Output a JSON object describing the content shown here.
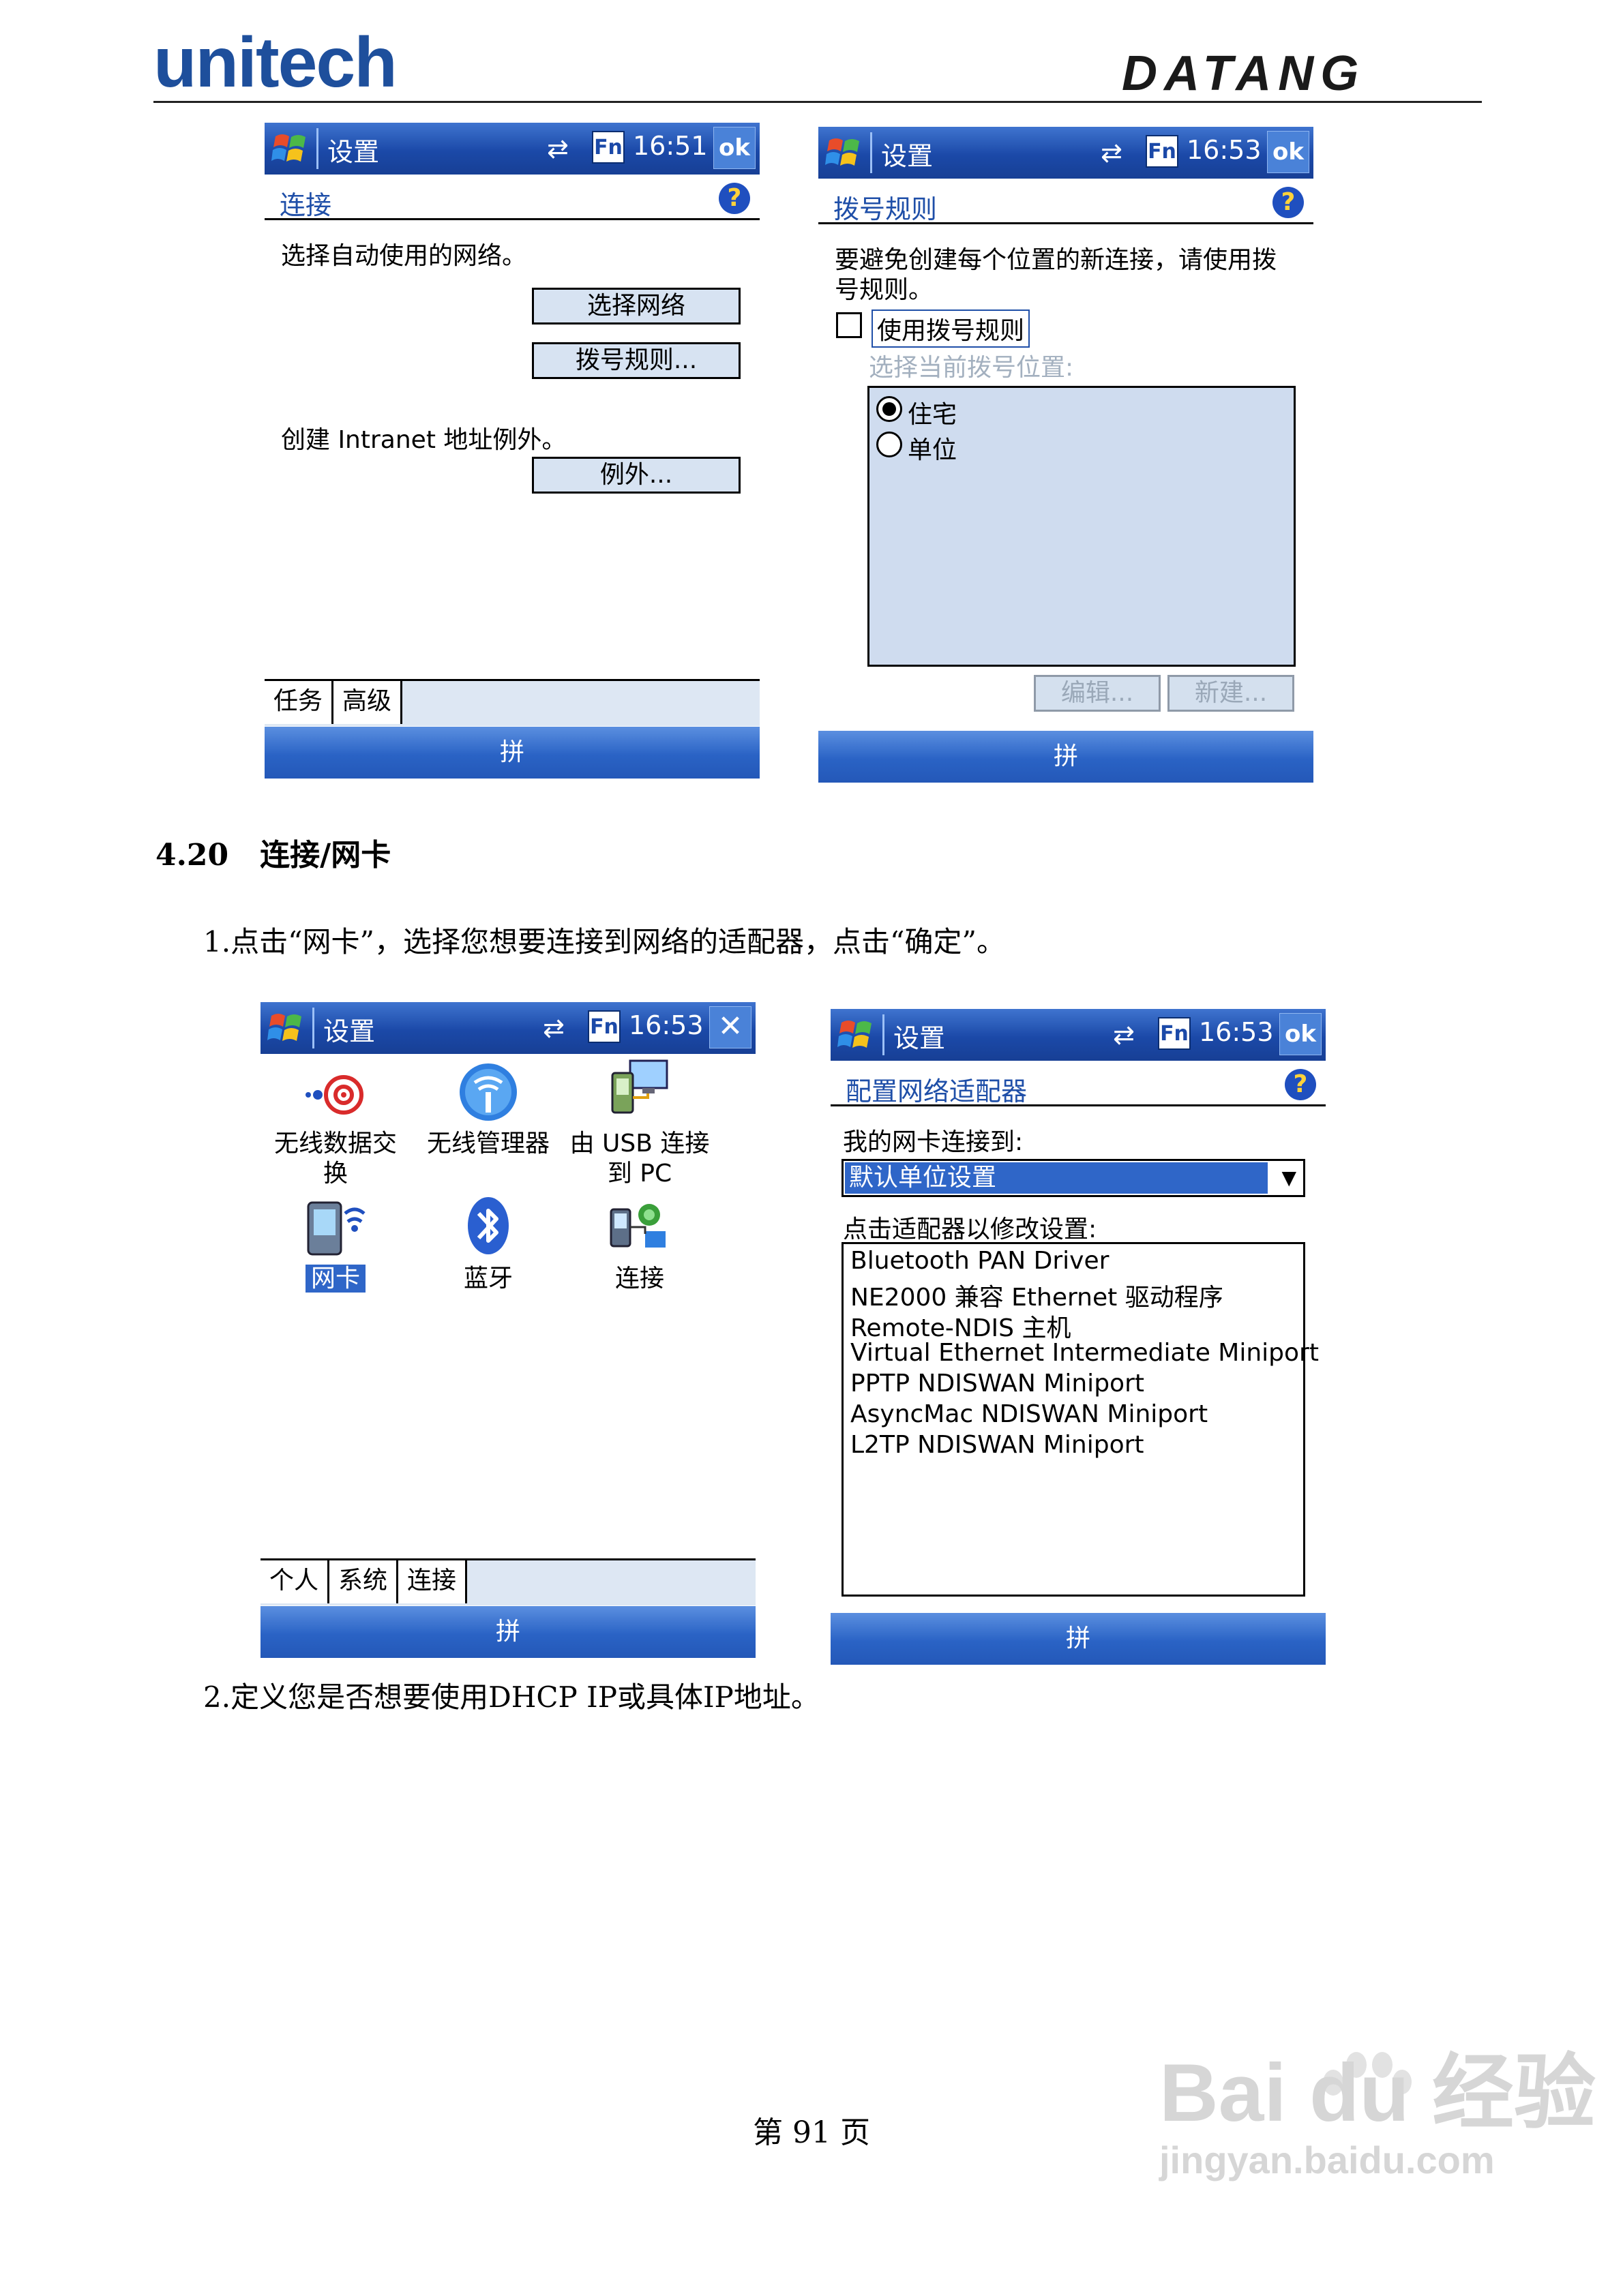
{
  "header": {
    "left_logo": "unitech",
    "right_logo": "DATANG"
  },
  "section": {
    "number": "4.20",
    "title": "连接/网卡"
  },
  "paragraph_1": "1.点击“网卡”，选择您想要连接到网络的适配器，点击“确定”。",
  "paragraph_2": "2.定义您是否想要使用DHCP IP或具体IP地址。",
  "page_number": "第 91 页",
  "watermark": {
    "line1": "Bai du 经验",
    "line2": "jingyan.baidu.com"
  },
  "screen1": {
    "title": "设置",
    "time": "16:51",
    "ok": "ok",
    "fn": "Fn",
    "subtitle": "连接",
    "prompt": "选择自动使用的网络。",
    "btn_select_network": "选择网络",
    "btn_dial_rules": "拨号规则...",
    "exception_prompt": "创建 Intranet 地址例外。",
    "btn_exceptions": "例外...",
    "tabs": [
      "任务",
      "高级"
    ],
    "sip": "拼"
  },
  "screen2": {
    "title": "设置",
    "time": "16:53",
    "ok": "ok",
    "fn": "Fn",
    "subtitle": "拨号规则",
    "desc_line1": "要避免创建每个位置的新连接，请使用拨",
    "desc_line2": "号规则。",
    "checkbox_label": "使用拨号规则",
    "location_label": "选择当前拨号位置:",
    "locations": [
      "住宅",
      "单位"
    ],
    "btn_edit": "编辑...",
    "btn_new": "新建...",
    "sip": "拼"
  },
  "screen3": {
    "title": "设置",
    "time": "16:53",
    "fn": "Fn",
    "close": "✕",
    "icons": [
      {
        "label_l1": "无线数据交",
        "label_l2": "换"
      },
      {
        "label_l1": "无线管理器",
        "label_l2": ""
      },
      {
        "label_l1": "由 USB 连接",
        "label_l2": "到 PC"
      },
      {
        "label_l1": "网卡",
        "label_l2": ""
      },
      {
        "label_l1": "蓝牙",
        "label_l2": ""
      },
      {
        "label_l1": "连接",
        "label_l2": ""
      }
    ],
    "tabs": [
      "个人",
      "系统",
      "连接"
    ],
    "sip": "拼"
  },
  "screen4": {
    "title": "设置",
    "time": "16:53",
    "ok": "ok",
    "fn": "Fn",
    "subtitle": "配置网络适配器",
    "connect_label": "我的网卡连接到:",
    "dropdown_value": "默认单位设置",
    "adapters_label": "点击适配器以修改设置:",
    "adapters": [
      "Bluetooth PAN Driver",
      "NE2000 兼容 Ethernet 驱动程序",
      "Remote-NDIS 主机",
      "Virtual Ethernet Intermediate Miniport",
      "PPTP NDISWAN Miniport",
      "AsyncMac NDISWAN Miniport",
      "L2TP NDISWAN Miniport"
    ],
    "sip": "拼"
  },
  "colors": {
    "titlebar": "#1b49a8",
    "accent_text": "#1f4fa8",
    "list_bg": "#cfdcef",
    "selected": "#2f66c8"
  }
}
